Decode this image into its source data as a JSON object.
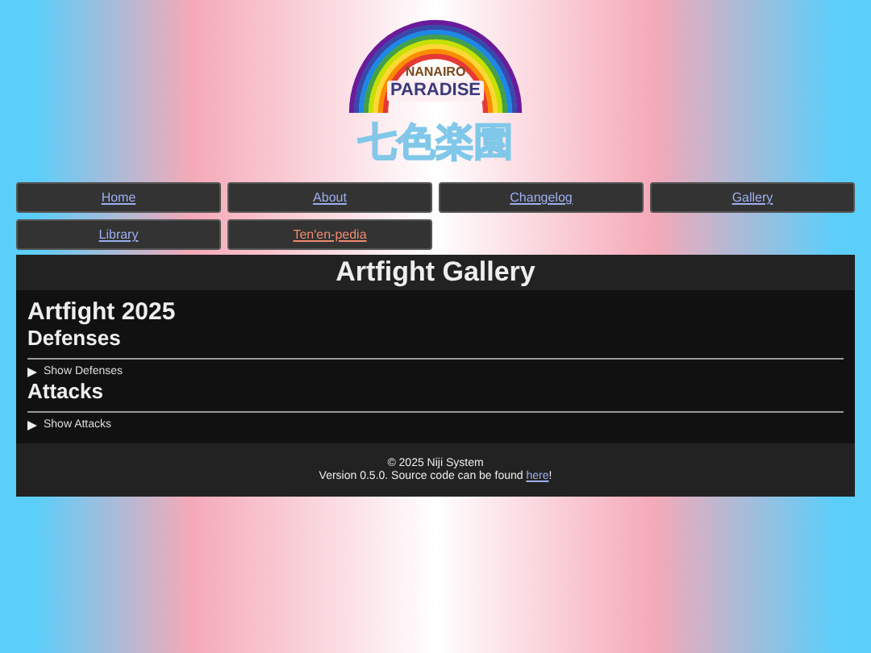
{
  "logo": {
    "top_text": "NANAIRO",
    "main_text": "PARADISE",
    "kanji": "七色楽園"
  },
  "nav": [
    {
      "label": "Home",
      "selected": false
    },
    {
      "label": "About",
      "selected": false
    },
    {
      "label": "Changelog",
      "selected": false
    },
    {
      "label": "Gallery",
      "selected": false
    },
    {
      "label": "Library",
      "selected": false
    },
    {
      "label": "Ten'en-pedia",
      "selected": true
    }
  ],
  "page_title": "Artfight Gallery",
  "heading": "Artfight 2025",
  "sections": [
    {
      "title": "Defenses",
      "toggle": "Show Defenses",
      "expanded": false
    },
    {
      "title": "Attacks",
      "toggle": "Show Attacks",
      "expanded": false
    }
  ],
  "footer": {
    "copyright": "© 2025 Niji System",
    "version_text": "Version 0.5.0. Source code can be found ",
    "link": "here",
    "after_link": "!"
  }
}
